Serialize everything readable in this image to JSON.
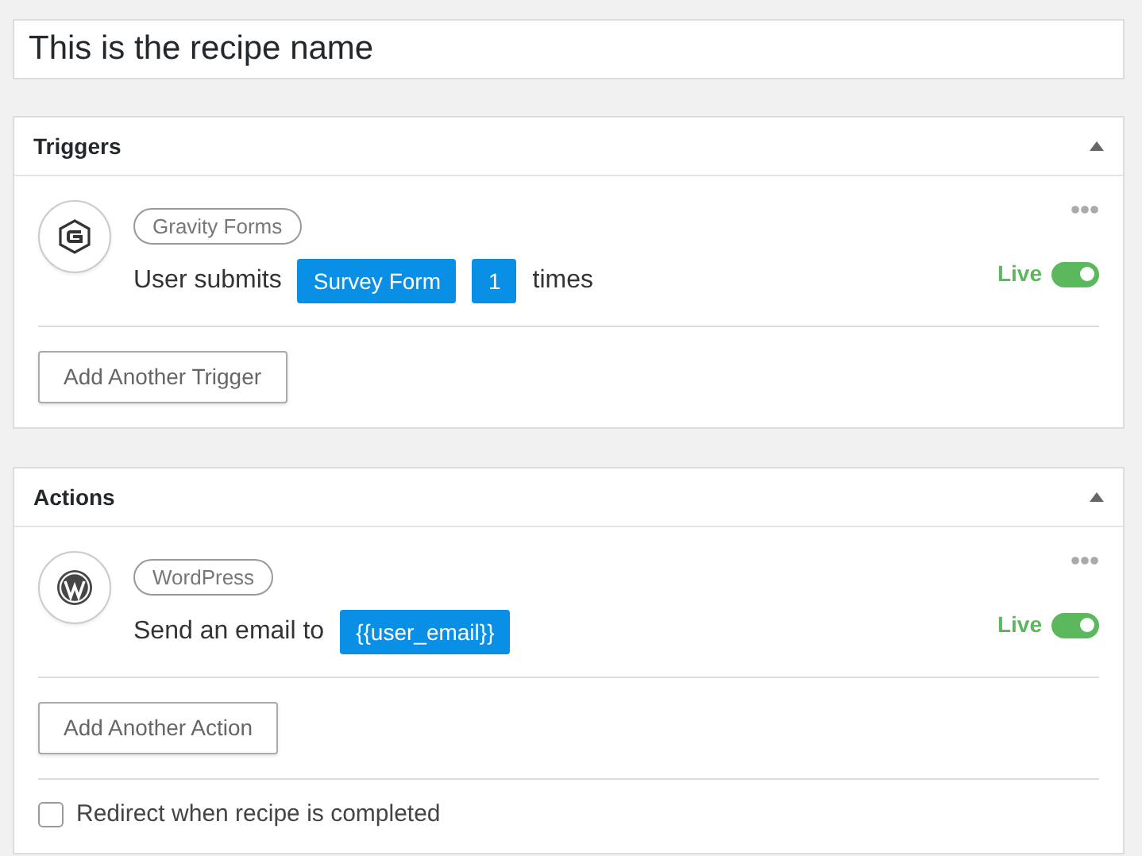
{
  "recipe_name": {
    "value": "This is the recipe name"
  },
  "panels": [
    {
      "title": "Triggers",
      "expanded": true,
      "items": [
        {
          "kind": "gravity",
          "integration": "Gravity Forms",
          "parts": [
            {
              "kind": "text",
              "text": "User submits"
            },
            {
              "kind": "token",
              "text": "Survey Form"
            },
            {
              "kind": "token",
              "text": "1"
            },
            {
              "kind": "text",
              "text": "times"
            }
          ],
          "status": "Live",
          "on": true
        }
      ],
      "add_button": "Add Another Trigger"
    },
    {
      "title": "Actions",
      "expanded": true,
      "items": [
        {
          "kind": "wordpress",
          "integration": "WordPress",
          "parts": [
            {
              "kind": "text",
              "text": "Send an email to"
            },
            {
              "kind": "token",
              "text": "{{user_email}}"
            }
          ],
          "status": "Live",
          "on": true
        }
      ],
      "add_button": "Add Another Action",
      "option": {
        "label": "Redirect when recipe is completed",
        "checked": false
      }
    }
  ]
}
